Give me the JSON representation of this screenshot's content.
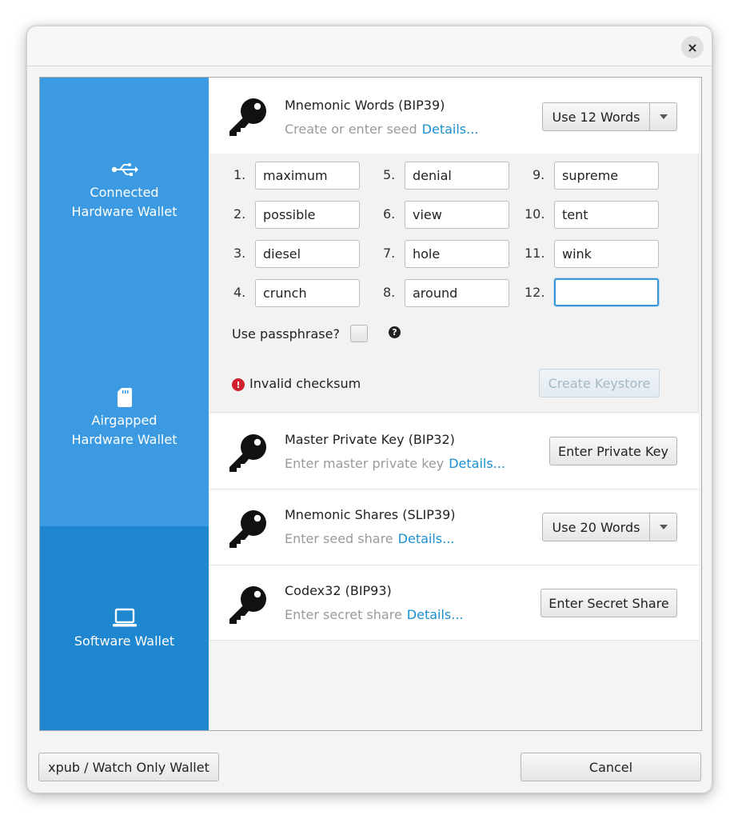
{
  "dialog": {
    "close_label": "×"
  },
  "sidebar": {
    "items": [
      {
        "icon": "usb-icon",
        "label": "Connected\nHardware Wallet"
      },
      {
        "icon": "sd-card-icon",
        "label": "Airgapped\nHardware Wallet"
      },
      {
        "icon": "laptop-icon",
        "label": "Software Wallet"
      }
    ]
  },
  "mnemonic": {
    "title": "Mnemonic Words (BIP39)",
    "subtitle": "Create or enter seed",
    "details_link": "Details...",
    "word_count_button": "Use 12 Words",
    "words": [
      {
        "num": "1.",
        "value": "maximum"
      },
      {
        "num": "2.",
        "value": "possible"
      },
      {
        "num": "3.",
        "value": "diesel"
      },
      {
        "num": "4.",
        "value": "crunch"
      },
      {
        "num": "5.",
        "value": "denial"
      },
      {
        "num": "6.",
        "value": "view"
      },
      {
        "num": "7.",
        "value": "hole"
      },
      {
        "num": "8.",
        "value": "around"
      },
      {
        "num": "9.",
        "value": "supreme"
      },
      {
        "num": "10.",
        "value": "tent"
      },
      {
        "num": "11.",
        "value": "wink"
      },
      {
        "num": "12.",
        "value": ""
      }
    ],
    "passphrase_label": "Use passphrase?",
    "help_glyph": "?",
    "error_glyph": "!",
    "error_text": "Invalid checksum",
    "create_button": "Create Keystore"
  },
  "master_key": {
    "title": "Master Private Key (BIP32)",
    "subtitle": "Enter master private key",
    "details_link": "Details...",
    "button": "Enter Private Key"
  },
  "shares": {
    "title": "Mnemonic Shares (SLIP39)",
    "subtitle": "Enter seed share",
    "details_link": "Details...",
    "button": "Use 20 Words"
  },
  "codex": {
    "title": "Codex32 (BIP93)",
    "subtitle": "Enter secret share",
    "details_link": "Details...",
    "button": "Enter Secret Share"
  },
  "footer": {
    "watch_only_button": "xpub / Watch Only Wallet",
    "cancel_button": "Cancel"
  }
}
